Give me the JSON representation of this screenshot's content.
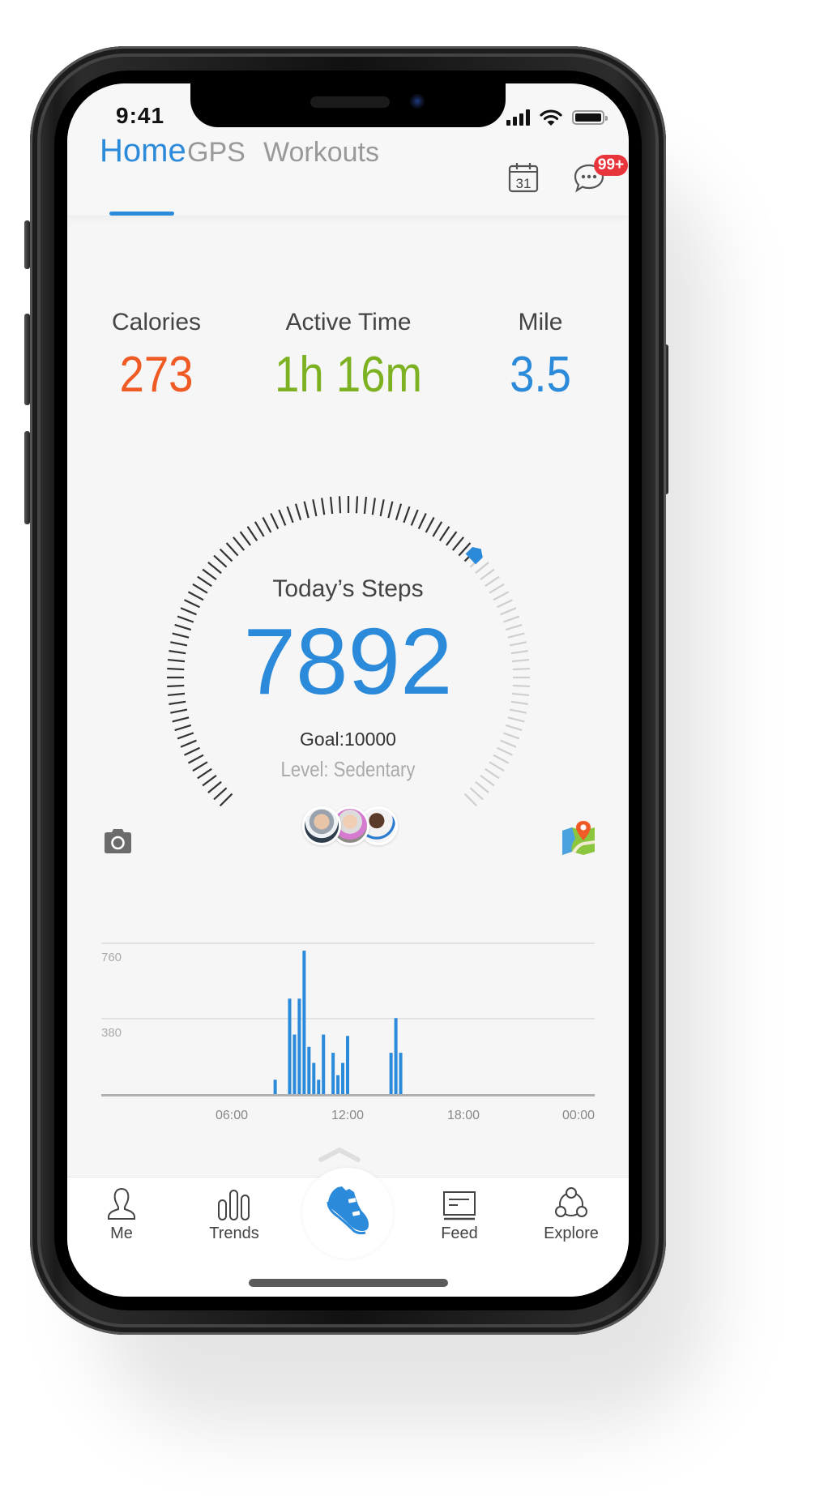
{
  "status_bar": {
    "time": "9:41",
    "signal_icon": "cellular-signal-icon",
    "wifi_icon": "wifi-icon",
    "battery_icon": "battery-icon"
  },
  "header": {
    "tabs": [
      {
        "label": "Home",
        "active": true
      },
      {
        "label": "GPS",
        "active": false
      },
      {
        "label": "Workouts",
        "active": false
      }
    ],
    "calendar_icon": "calendar-icon",
    "calendar_day": "31",
    "messages_icon": "chat-bubble-icon",
    "messages_badge": "99+"
  },
  "stats": [
    {
      "label": "Calories",
      "value": "273",
      "color": "#f05a24"
    },
    {
      "label": "Active Time",
      "value": "1h 16m",
      "color": "#7cb121"
    },
    {
      "label": "Mile",
      "value": "3.5",
      "color": "#2b8ad9"
    }
  ],
  "steps": {
    "title": "Today’s Steps",
    "value": "7892",
    "goal": "Goal:10000",
    "level": "Level: Sedentary",
    "gauge_progress_fraction": 0.67,
    "accent": "#2b8ad9"
  },
  "friends_avatars": [
    "friend-1",
    "friend-2",
    "friend-3"
  ],
  "actions": {
    "camera_icon": "camera-icon",
    "map_icon": "map-pin-icon"
  },
  "chart_data": {
    "type": "bar",
    "title": "",
    "xlabel": "",
    "ylabel": "",
    "x_unit": "hour",
    "xlim": [
      0,
      24
    ],
    "ylim": [
      0,
      760
    ],
    "yticks": [
      380,
      760
    ],
    "ytick_labels": [
      "380",
      "760"
    ],
    "xticks": [
      6,
      12,
      18,
      24
    ],
    "xtick_labels": [
      "06:00",
      "12:00",
      "18:00",
      "00:00"
    ],
    "grid": true,
    "x": [
      8.25,
      9.0,
      9.25,
      9.5,
      9.75,
      10.0,
      10.25,
      10.5,
      10.75,
      11.25,
      11.5,
      11.75,
      12.0,
      14.25,
      14.5,
      14.75
    ],
    "values": [
      72,
      481,
      300,
      481,
      723,
      238,
      157,
      72,
      300,
      208,
      95,
      157,
      293,
      208,
      383,
      208
    ],
    "color": "#2b8ad9"
  },
  "bottom_nav": {
    "items": [
      {
        "label": "Me",
        "icon": "person-icon"
      },
      {
        "label": "Trends",
        "icon": "bar-chart-icon"
      },
      {
        "label": "",
        "icon": "sneaker-icon"
      },
      {
        "label": "Feed",
        "icon": "newspaper-icon"
      },
      {
        "label": "Explore",
        "icon": "community-icon"
      }
    ]
  }
}
